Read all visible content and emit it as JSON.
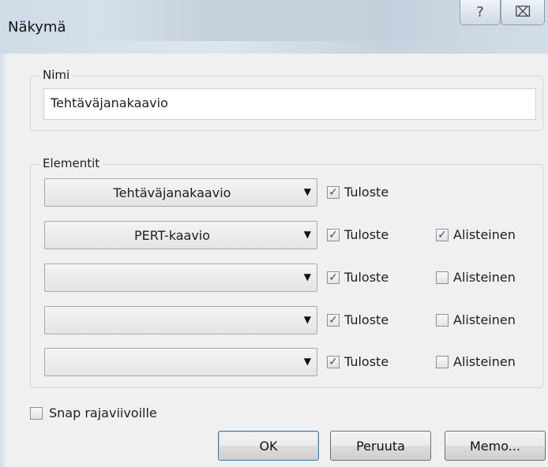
{
  "window": {
    "title": "Näkymä"
  },
  "titlebar_buttons": {
    "help": "?",
    "close": "⌧"
  },
  "nimi": {
    "legend": "Nimi",
    "value": "Tehtäväjanakaavio"
  },
  "elementit": {
    "legend": "Elementit",
    "rows": [
      {
        "dropdown": "Tehtäväjanakaavio",
        "tuloste_label": "Tuloste",
        "tuloste_checked": true,
        "alisteinen_label": "",
        "alisteinen_checked": null
      },
      {
        "dropdown": "PERT-kaavio",
        "tuloste_label": "Tuloste",
        "tuloste_checked": true,
        "alisteinen_label": "Alisteinen",
        "alisteinen_checked": true
      },
      {
        "dropdown": "",
        "tuloste_label": "Tuloste",
        "tuloste_checked": true,
        "alisteinen_label": "Alisteinen",
        "alisteinen_checked": false
      },
      {
        "dropdown": "",
        "tuloste_label": "Tuloste",
        "tuloste_checked": true,
        "alisteinen_label": "Alisteinen",
        "alisteinen_checked": false
      },
      {
        "dropdown": "",
        "tuloste_label": "Tuloste",
        "tuloste_checked": true,
        "alisteinen_label": "Alisteinen",
        "alisteinen_checked": false
      }
    ]
  },
  "snap": {
    "label": "Snap rajaviivoille",
    "checked": false
  },
  "buttons": {
    "ok": "OK",
    "cancel": "Peruuta",
    "memo": "Memo..."
  },
  "icons": {
    "checkmark": "✓",
    "dropdown_arrow": "▼"
  }
}
